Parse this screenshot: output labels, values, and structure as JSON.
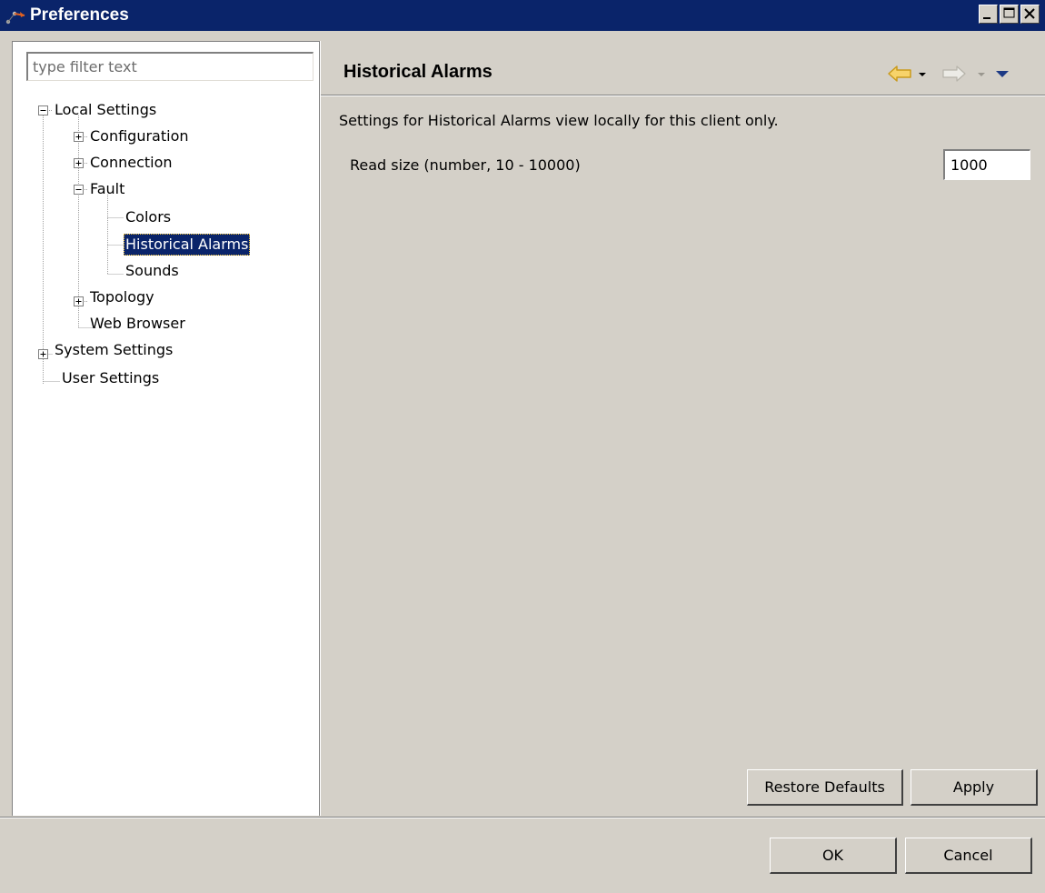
{
  "window": {
    "title": "Preferences"
  },
  "filter": {
    "placeholder": "type filter text",
    "value": ""
  },
  "tree": {
    "local_settings": "Local Settings",
    "configuration": "Configuration",
    "connection": "Connection",
    "fault": "Fault",
    "colors": "Colors",
    "historical_alarms": "Historical Alarms",
    "sounds": "Sounds",
    "topology": "Topology",
    "web_browser": "Web Browser",
    "system_settings": "System Settings",
    "user_settings": "User Settings"
  },
  "page": {
    "title": "Historical Alarms",
    "description": "Settings for Historical Alarms view locally for this client only.",
    "read_size_label": "Read size (number, 10 - 10000)",
    "read_size_value": "1000"
  },
  "buttons": {
    "restore_defaults": "Restore Defaults",
    "apply": "Apply",
    "ok": "OK",
    "cancel": "Cancel"
  },
  "colors": {
    "titlebar": "#0a246a",
    "selection": "#0a246a",
    "back_arrow": "#f4c542"
  },
  "icons": {
    "app": "preferences-icon",
    "back": "back-arrow-icon",
    "forward": "forward-arrow-icon",
    "menu": "view-menu-icon"
  }
}
